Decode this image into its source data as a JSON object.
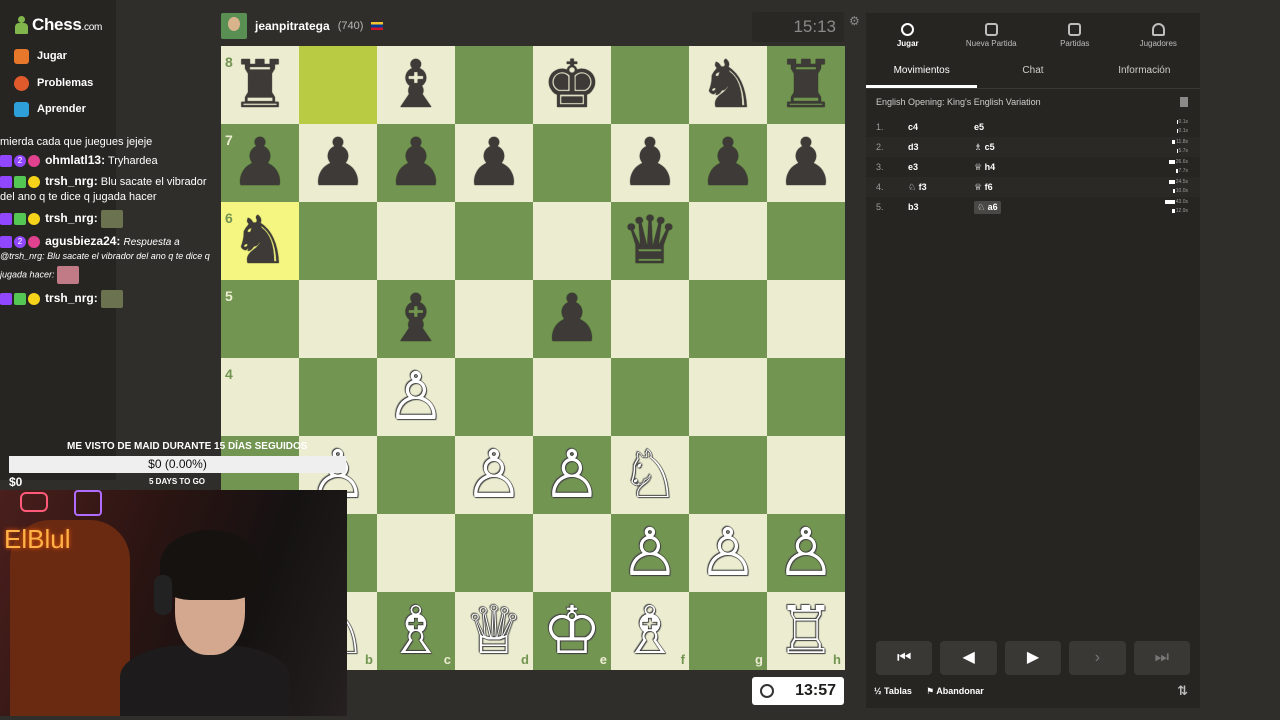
{
  "sidebar": {
    "logo_text": "Chess",
    "logo_suffix": ".com",
    "items": [
      {
        "label": "Jugar"
      },
      {
        "label": "Problemas"
      },
      {
        "label": "Aprender"
      }
    ]
  },
  "chat": {
    "lines": [
      {
        "text": "mierda cada que juegues jejeje"
      },
      {
        "user": "ohmlatl13:",
        "text": "Tryhardea"
      },
      {
        "user": "trsh_nrg:",
        "text": "Blu sacate el vibrador"
      },
      {
        "text": "del ano q te dice q jugada hacer"
      },
      {
        "user": "trsh_nrg:"
      },
      {
        "user": "agusbieza24:",
        "text": "Respuesta a"
      },
      {
        "text": "@trsh_nrg: Blu sacate el vibrador del ano q te dice q"
      },
      {
        "text": "jugada hacer:"
      },
      {
        "user": "trsh_nrg:"
      }
    ],
    "badge_numbers": [
      "2",
      "2"
    ]
  },
  "top_player": {
    "name": "jeanpitratega",
    "rating": "(740)",
    "clock": "15:13"
  },
  "bottom_player": {
    "clock": "13:57"
  },
  "board": {
    "ranks": [
      "8",
      "7",
      "6",
      "5",
      "4"
    ],
    "files": [
      "b",
      "c",
      "d",
      "e",
      "f",
      "g",
      "h"
    ],
    "colors": {
      "light": "#ebecd0",
      "dark": "#739552",
      "highlight_light": "#f5f682",
      "highlight_dark": "#b9ca43"
    },
    "pieces": [
      {
        "sq": "a8",
        "p": "♜",
        "c": "b"
      },
      {
        "sq": "c8",
        "p": "♝",
        "c": "b"
      },
      {
        "sq": "e8",
        "p": "♚",
        "c": "b"
      },
      {
        "sq": "g8",
        "p": "♞",
        "c": "b"
      },
      {
        "sq": "h8",
        "p": "♜",
        "c": "b"
      },
      {
        "sq": "a7",
        "p": "♟",
        "c": "b"
      },
      {
        "sq": "b7",
        "p": "♟",
        "c": "b"
      },
      {
        "sq": "c7",
        "p": "♟",
        "c": "b"
      },
      {
        "sq": "d7",
        "p": "♟",
        "c": "b"
      },
      {
        "sq": "f7",
        "p": "♟",
        "c": "b"
      },
      {
        "sq": "g7",
        "p": "♟",
        "c": "b"
      },
      {
        "sq": "h7",
        "p": "♟",
        "c": "b"
      },
      {
        "sq": "a6",
        "p": "♞",
        "c": "b"
      },
      {
        "sq": "f6",
        "p": "♛",
        "c": "b"
      },
      {
        "sq": "c5",
        "p": "♝",
        "c": "b"
      },
      {
        "sq": "e5",
        "p": "♟",
        "c": "b"
      },
      {
        "sq": "c4",
        "p": "♙",
        "c": "w"
      },
      {
        "sq": "b3",
        "p": "♙",
        "c": "w"
      },
      {
        "sq": "d3",
        "p": "♙",
        "c": "w"
      },
      {
        "sq": "e3",
        "p": "♙",
        "c": "w"
      },
      {
        "sq": "f3",
        "p": "♘",
        "c": "w"
      },
      {
        "sq": "f2",
        "p": "♙",
        "c": "w"
      },
      {
        "sq": "g2",
        "p": "♙",
        "c": "w"
      },
      {
        "sq": "h2",
        "p": "♙",
        "c": "w"
      },
      {
        "sq": "b1",
        "p": "♘",
        "c": "w"
      },
      {
        "sq": "c1",
        "p": "♗",
        "c": "w"
      },
      {
        "sq": "d1",
        "p": "♕",
        "c": "w"
      },
      {
        "sq": "e1",
        "p": "♔",
        "c": "w"
      },
      {
        "sq": "f1",
        "p": "♗",
        "c": "w"
      },
      {
        "sq": "h1",
        "p": "♖",
        "c": "w"
      }
    ],
    "highlights": [
      "b8",
      "a6"
    ]
  },
  "panel": {
    "tabs": [
      {
        "label": "Jugar",
        "icon": "stopwatch-icon"
      },
      {
        "label": "Nueva Partida",
        "icon": "plus-icon"
      },
      {
        "label": "Partidas",
        "icon": "board-icon"
      },
      {
        "label": "Jugadores",
        "icon": "users-icon"
      }
    ],
    "subtabs": [
      "Movimientos",
      "Chat",
      "Información"
    ],
    "opening": "English Opening: King's English Variation",
    "moves": [
      {
        "n": "1.",
        "w": "c4",
        "b": "e5",
        "tw": "0.1s",
        "tb": "0.1s",
        "fw": 0.02,
        "fb": 0.02
      },
      {
        "n": "2.",
        "w": "d3",
        "b": "♗ c5",
        "tw": "11.8s",
        "tb": "5.7s",
        "fw": 0.27,
        "fb": 0.13
      },
      {
        "n": "3.",
        "w": "e3",
        "b": "♕ h4",
        "tw": "26.6s",
        "tb": "7.7s",
        "fw": 0.62,
        "fb": 0.18
      },
      {
        "n": "4.",
        "w": "♘ f3",
        "b": "♕ f6",
        "tw": "24.5s",
        "tb": "10.0s",
        "fw": 0.57,
        "fb": 0.23
      },
      {
        "n": "5.",
        "w": "b3",
        "b": "♘ a6",
        "tw": "43.0s",
        "tb": "12.9s",
        "fw": 1.0,
        "fb": 0.3
      }
    ],
    "nav": {
      "first": "⏮",
      "prev": "◀",
      "play": "▶",
      "next": "›",
      "last": "⏭"
    },
    "draw_label": "½ Tablas",
    "resign_label": "⚑ Abandonar",
    "flip_icon": "⇅"
  },
  "overlay": {
    "goal_title": "ME VISTO DE MAID DURANTE 15 DÍAS SEGUIDOS",
    "goal_bar": "$0 (0.00%)",
    "goal_progress": 0,
    "goal_current": "$0",
    "goal_days": "5 DAYS TO GO",
    "streamer": "ElBlul"
  }
}
